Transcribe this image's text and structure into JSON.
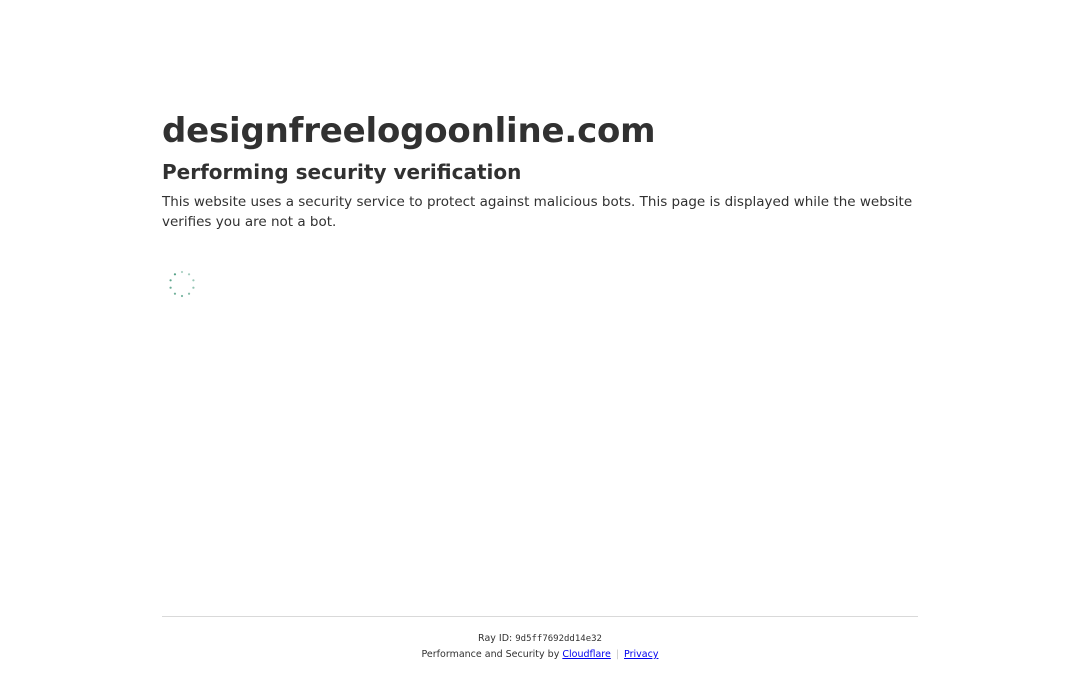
{
  "page": {
    "site_name": "designfreelogoonline.com",
    "heading": "Performing security verification",
    "description": "This website uses a security service to protect against malicious bots. This page is displayed while the website verifies you are not a bot."
  },
  "spinner": {
    "icon": "loading-spinner-icon",
    "color": "#4a9b7f"
  },
  "footer": {
    "ray_label": "Ray ID: ",
    "ray_id": "9d5ff7692dd14e32",
    "perf_text": "Performance and Security by ",
    "cloudflare_link": "Cloudflare",
    "separator": "|",
    "privacy_link": "Privacy"
  }
}
